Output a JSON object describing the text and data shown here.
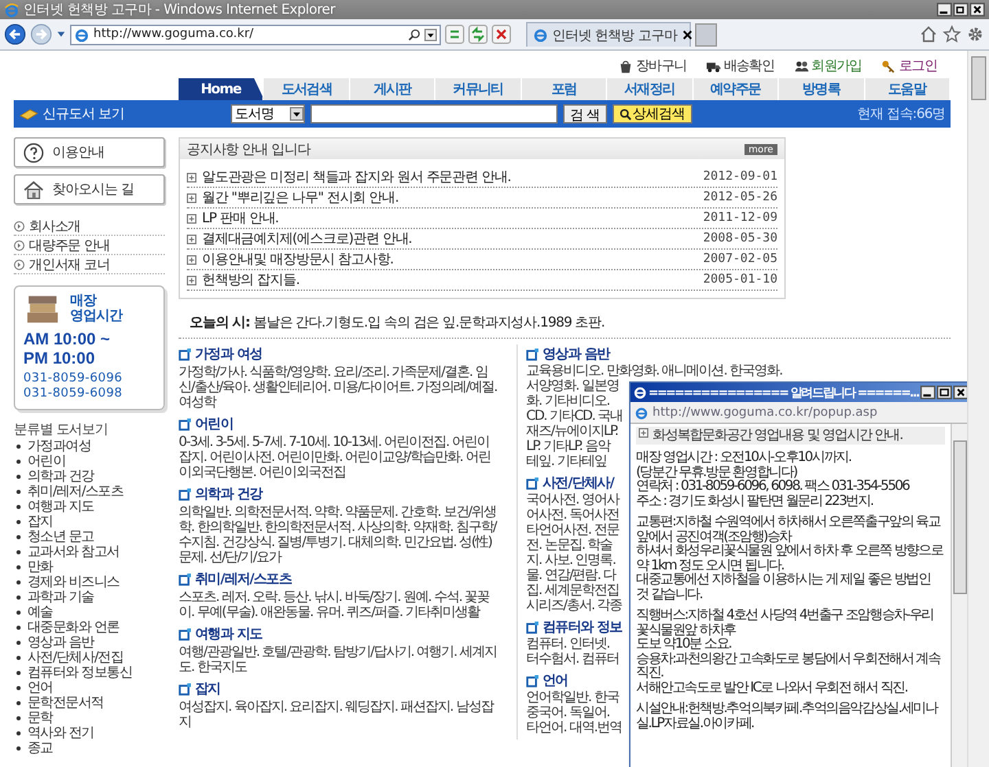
{
  "browser": {
    "title": "인터넷 헌책방 고구마 - Windows Internet Explorer",
    "address": "http://www.goguma.co.kr/",
    "tab": "인터넷 헌책방 고구마"
  },
  "top_links": [
    {
      "label": "장바구니",
      "kind": "cart"
    },
    {
      "label": "배송확인",
      "kind": "truck"
    },
    {
      "label": "회원가입",
      "kind": "people"
    },
    {
      "label": "로그인",
      "kind": "key"
    }
  ],
  "nav_tabs": [
    {
      "label": "Home",
      "selected": true
    },
    {
      "label": "도서검색",
      "selected": false
    },
    {
      "label": "게시판",
      "selected": false
    },
    {
      "label": "커뮤니티",
      "selected": false
    },
    {
      "label": "포럼",
      "selected": false
    },
    {
      "label": "서재정리",
      "selected": false
    },
    {
      "label": "예약주문",
      "selected": false
    },
    {
      "label": "방명록",
      "selected": false
    },
    {
      "label": "도움말",
      "selected": false
    }
  ],
  "search_bar": {
    "promo": "신규도서 보기",
    "field_select": "도서명",
    "search_button": "검 색",
    "advanced_button": "상세검색",
    "visitors": "현재 접속:66명"
  },
  "sidebar": {
    "buttons": [
      {
        "label": "이용안내",
        "kind": "help"
      },
      {
        "label": "찾아오시는 길",
        "kind": "home"
      }
    ],
    "links": [
      "회사소개",
      "대량주문 안내",
      "개인서재 코너"
    ],
    "hours_box": {
      "title_lines": [
        "매장",
        "영업시간"
      ],
      "hours": [
        "AM 10:00 ~",
        "PM 10:00"
      ],
      "phones": [
        "031-8059-6096",
        "031-8059-6098"
      ]
    },
    "categories_title": "분류별 도서보기",
    "categories": [
      "가정과여성",
      "어린이",
      "의학과 건강",
      "취미/레저/스포츠",
      "여행과 지도",
      "잡지",
      "청소년 문고",
      "교과서와 참고서",
      "만화",
      "경제와 비즈니스",
      "과학과 기술",
      "예술",
      "대중문화와 언론",
      "영상과 음반",
      "사전/단체사/전집",
      "컴퓨터와 정보통신",
      "언어",
      "문학전문서적",
      "문학",
      "역사와 전기",
      "종교"
    ]
  },
  "notices": {
    "title": "공지사항 안내 입니다",
    "more": "more",
    "items": [
      {
        "title": "알도관광은 미정리 책들과 잡지와 원서 주문관련 안내.",
        "date": "2012-09-01"
      },
      {
        "title": "월간 \"뿌리깊은 나무\" 전시회 안내.",
        "date": "2012-05-26"
      },
      {
        "title": "LP 판매 안내.",
        "date": "2011-12-09"
      },
      {
        "title": "결제대금예치제(에스크로)관련 안내.",
        "date": "2008-05-30"
      },
      {
        "title": "이용안내및 매장방문시 참고사항.",
        "date": "2007-02-05"
      },
      {
        "title": "헌책방의 잡지들.",
        "date": "2005-01-10"
      }
    ]
  },
  "poem": "**오늘의 시:** 봄날은 간다.기형도.입 속의 검은 잎.문학과지성사.1989 초판.",
  "categories_left": [
    {
      "title": "가정과 여성",
      "text": "가정학/가사. 식품학/영양학. 요리/조리. 가족문제/결혼. 임신/출산/육아. 생활인테리어. 미용/다이어트. 가정의례/예절. 여성학"
    },
    {
      "title": "어린이",
      "text": "0-3세. 3-5세. 5-7세. 7-10세. 10-13세. 어린이전집. 어린이잡지. 어린이사전. 어린이만화. 어린이교양/학습만화. 어린이외국단행본. 어린이외국전집"
    },
    {
      "title": "의학과 건강",
      "text": "의학일반. 의학전문서적. 약학. 약품문제. 간호학. 보건/위생학. 한의학일반. 한의학전문서적. 사상의학. 약재학. 침구학/수지침. 건강상식. 질병/투병기. 대체의학. 민간요법. 성(性)문제. 선/단/기/요가"
    },
    {
      "title": "취미/레저/스포츠",
      "text": "스포츠. 레저. 오락. 등산. 낚시. 바둑/장기. 원예. 수석. 꽃꽂이. 무예(무술). 애완동물. 유머. 퀴즈/퍼즐. 기타취미생활"
    },
    {
      "title": "여행과 지도",
      "text": "여행/관광일반. 호텔/관광학. 탐방기/답사기. 여행기. 세계지도. 한국지도"
    },
    {
      "title": "잡지",
      "text": "여성잡지. 육아잡지. 요리잡지. 웨딩잡지. 패션잡지. 남성잡지"
    }
  ],
  "categories_right": [
    {
      "title": "영상과 음반",
      "lines": [
        "교육용비디오. 만화영화. 애니메이션. 한국영화.",
        "서양영화. 일본영",
        "화. 기타비디오.",
        "CD. 기타CD. 국내",
        "재즈/뉴에이지LP.",
        "LP. 기타LP. 음악",
        "테잎. 기타테잎"
      ]
    },
    {
      "title": "사전/단체사/",
      "lines": [
        "국어사전. 영어사",
        "어사전. 독어사전",
        "타언어사전. 전문",
        "전. 논문집. 학술",
        "지. 사보. 인명록.",
        "물. 연감/편람. 다",
        "집. 세계문학전집",
        "시리즈/총서. 각종"
      ]
    },
    {
      "title": "컴퓨터와 정보",
      "lines": [
        "컴퓨터. 인터넷.",
        "터수험서. 컴퓨터"
      ]
    },
    {
      "title": "언어",
      "lines": [
        "언어학일반. 한국",
        "중국어. 독일어.",
        "타언어. 대역.번역"
      ]
    }
  ],
  "popup": {
    "title": "================ 알려드립니다 ======...",
    "address": "http://www.goguma.co.kr/popup.asp",
    "heading": "화성복합문화공간 영업내용 및 영업시간 안내.",
    "paragraphs": [
      [
        "매장 영업시간 : 오전10시-오후10시까지.",
        "(당분간 무휴.방문 환영합니다)",
        "연락처 : 031-8059-6096, 6098. 팩스 031-354-5506",
        "주소 : 경기도 화성시 팔탄면 월문리 223번지."
      ],
      [
        "교통편:지하철 수원역에서 하차해서 오른쪽출구앞의 육교앞에서 공진여객(조암행)승차",
        "하셔서 화성우리꽃식물원 앞에서 하차 후 오른쪽 방향으로 약 1km 정도 오시면 됩니다.",
        "대중교통에선 지하철을 이용하시는 게 제일 좋은 방법인 것 같습니다."
      ],
      [
        "직행버스:지하철 4호선 사당역 4번출구 조암행승차-우리꽃식물원앞 하차후",
        "도보 약10분 소요.",
        "승용차:과천의왕간 고속화도로 봉담에서 우회전해서 계속 직진.",
        "서해안고속도로 발안 IC로 나와서 우회전 해서 직진."
      ],
      [
        "시설안내:헌책방.추억의북카페.추억의음악감상실.세미나실.LP자료실.아이카페."
      ]
    ]
  }
}
